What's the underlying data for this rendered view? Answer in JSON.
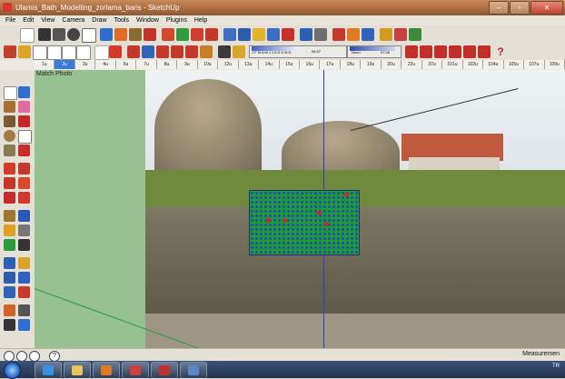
{
  "window": {
    "title": "Ulamis_Bath_Modelling_zorlama_baris - SketchUp",
    "minimize": "–",
    "maximize": "▫",
    "close": "✕"
  },
  "menubar": {
    "items": [
      "File",
      "Edit",
      "View",
      "Camera",
      "Draw",
      "Tools",
      "Window",
      "Plugins",
      "Help"
    ]
  },
  "toolbar": {
    "shadow_months": "J F M A M J J A S O N D",
    "shadow_time_left": "06:37",
    "shadow_noon": "Noon",
    "shadow_time_right": "07:28"
  },
  "scene_tabs": [
    "1u",
    "2u",
    "3u",
    "4u",
    "6u",
    "7u",
    "8u",
    "9u",
    "10u",
    "12u",
    "13u",
    "14u",
    "15u",
    "16u",
    "17u",
    "18u",
    "19u",
    "20u",
    "22u",
    "37u",
    "101u",
    "102u",
    "104u",
    "105u",
    "107u",
    "109u"
  ],
  "viewport": {
    "label": "Match Photo"
  },
  "status": {
    "measurements_label": "Measuremen",
    "help_icon_text": "?"
  },
  "taskbar": {
    "tray_text": "TR"
  },
  "colors": {
    "accent_scene": "#3a7bd5",
    "viewport_bg": "#98c191",
    "overlay_green": "#1b9e2f",
    "overlay_blue": "#2c3ed0",
    "axis_blue": "#2b3ec2",
    "axis_green": "#2aa040"
  }
}
